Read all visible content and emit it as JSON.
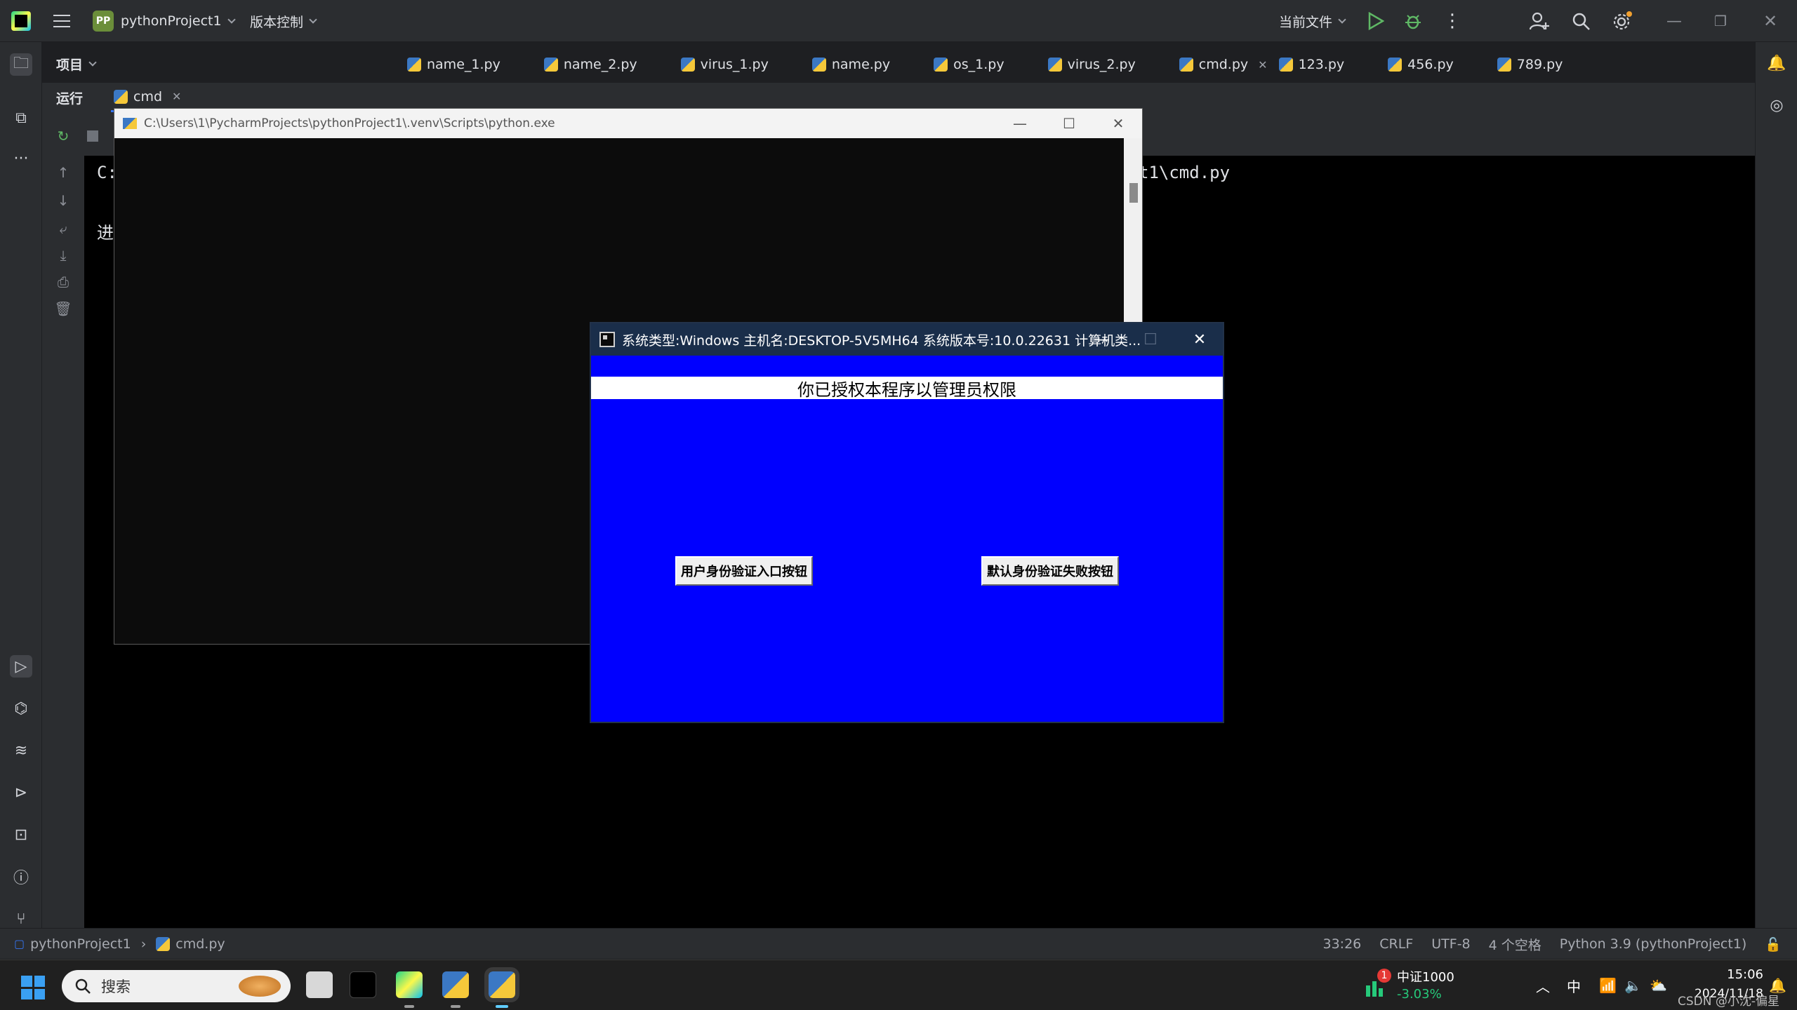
{
  "topbar": {
    "project_name": "pythonProject1",
    "project_badge": "PP",
    "vcs_label": "版本控制",
    "current_file_label": "当前文件"
  },
  "sidebar": {
    "project_label": "项目"
  },
  "editor_tabs": [
    {
      "label": "name_1.py"
    },
    {
      "label": "name_2.py"
    },
    {
      "label": "virus_1.py"
    },
    {
      "label": "name.py"
    },
    {
      "label": "os_1.py"
    },
    {
      "label": "virus_2.py"
    },
    {
      "label": "cmd.py",
      "active": true
    },
    {
      "label": "123.py"
    },
    {
      "label": "456.py"
    },
    {
      "label": "789.py"
    }
  ],
  "run_panel": {
    "label": "运行",
    "tab_label": "cmd",
    "console_line1_left": "C:",
    "console_line1_right": "t1\\cmd.py",
    "console_line2_left": "进"
  },
  "cmd_window": {
    "title": "C:\\Users\\1\\PycharmProjects\\pythonProject1\\.venv\\Scripts\\python.exe"
  },
  "tk_window": {
    "title": "系统类型:Windows 主机名:DESKTOP-5V5MH64 系统版本号:10.0.22631 计算机类...",
    "banner": "你已授权本程序以管理员权限",
    "button_left": "用户身份验证入口按钮",
    "button_right": "默认身份验证失败按钮",
    "background_color": "#0000ff"
  },
  "statusbar": {
    "breadcrumb_project": "pythonProject1",
    "breadcrumb_file": "cmd.py",
    "position": "33:26",
    "line_sep": "CRLF",
    "encoding": "UTF-8",
    "indent": "4 个空格",
    "interpreter": "Python 3.9 (pythonProject1)"
  },
  "taskbar": {
    "search_placeholder": "搜索",
    "stock_name": "中证1000",
    "stock_change": "-3.03%",
    "stock_badge": "1",
    "ime": "中",
    "time": "15:06",
    "date": "2024/11/18",
    "watermark": "CSDN @小沈-偏星"
  },
  "colors": {
    "ide_bg": "#2b2d30",
    "accent": "#3574f0",
    "stock_down": "#26c97a"
  }
}
